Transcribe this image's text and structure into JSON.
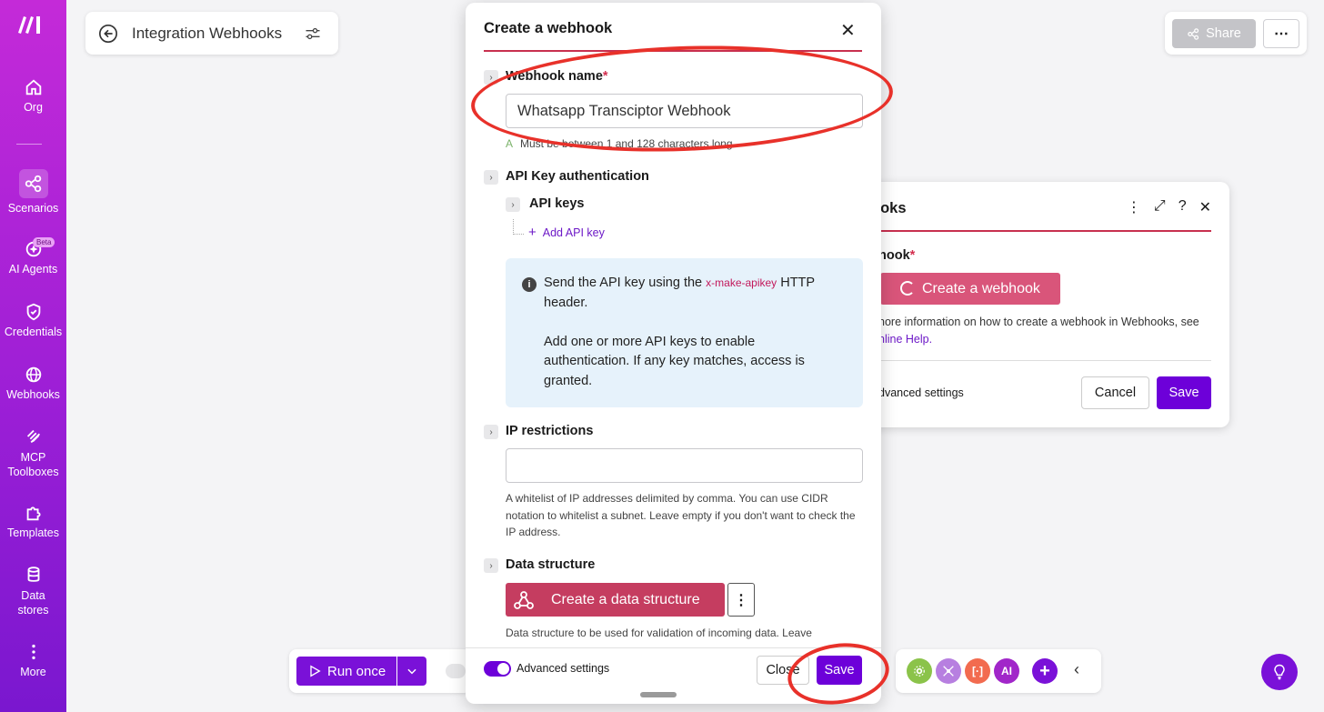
{
  "sidebar": {
    "items": [
      {
        "label": "Org"
      },
      {
        "label": "Scenarios"
      },
      {
        "label": "AI Agents",
        "badge": "Beta"
      },
      {
        "label": "Credentials"
      },
      {
        "label": "Webhooks"
      },
      {
        "label": "MCP Toolboxes"
      },
      {
        "label": "Templates"
      },
      {
        "label": "Data stores"
      },
      {
        "label": "More"
      }
    ]
  },
  "header": {
    "title": "Integration Webhooks"
  },
  "top_actions": {
    "share_label": "Share",
    "more_label": "⋯"
  },
  "module_panel": {
    "title": "ooks",
    "field_label": "hook",
    "create_label": "Create a webhook",
    "help_text": "nore information on how to create a webhook in Webhooks, see",
    "help_link": "nline Help.",
    "advanced_label": "dvanced settings",
    "cancel_label": "Cancel",
    "save_label": "Save"
  },
  "dialog": {
    "title": "Create a webhook",
    "name_label": "Webhook name",
    "name_value": "Whatsapp Transciptor Webhook",
    "name_hint": "Must be between 1 and 128 characters long.",
    "api_auth_label": "API Key authentication",
    "api_keys_label": "API keys",
    "add_key_label": "Add API key",
    "info_pre": "Send the API key using the ",
    "info_code": "x-make-apikey",
    "info_post": " HTTP header.",
    "info_para2": "Add one or more API keys to enable authentication. If any key matches, access is granted.",
    "ip_label": "IP restrictions",
    "ip_value": "",
    "ip_hint": "A whitelist of IP addresses delimited by comma. You can use CIDR notation to whitelist a subnet. Leave empty if you don't want to check the IP address.",
    "ds_label": "Data structure",
    "ds_button": "Create a data structure",
    "ds_hint": "Data structure to be used for validation of incoming data. Leave",
    "advanced_label": "Advanced settings",
    "close_label": "Close",
    "save_label": "Save"
  },
  "toolbar": {
    "run_label": "Run once",
    "tools": [
      {
        "label": "",
        "color": "#8bc34a"
      },
      {
        "label": "",
        "color": "#b77fe0"
      },
      {
        "label": "[·]",
        "color": "#f26b4f"
      },
      {
        "label": "AI",
        "color": "#a126c9"
      },
      {
        "label": "+",
        "color": "#7a11d8"
      }
    ]
  },
  "colors": {
    "brand": "#6d00d9",
    "accent_line": "#c8304f",
    "annotation": "#e8312a"
  }
}
